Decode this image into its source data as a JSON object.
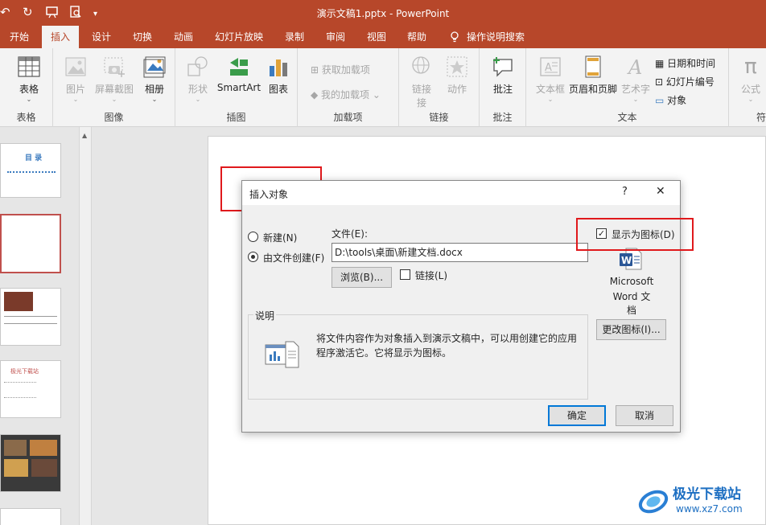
{
  "titlebar": {
    "title": "演示文稿1.pptx  -  PowerPoint",
    "qa_icons": [
      "undo-icon",
      "redo-icon",
      "start-from-beginning-icon",
      "print-preview-icon",
      "customize-qa-icon"
    ]
  },
  "tabs": [
    {
      "label": "开始"
    },
    {
      "label": "插入",
      "active": true
    },
    {
      "label": "设计"
    },
    {
      "label": "切换"
    },
    {
      "label": "动画"
    },
    {
      "label": "幻灯片放映"
    },
    {
      "label": "录制"
    },
    {
      "label": "审阅"
    },
    {
      "label": "视图"
    },
    {
      "label": "帮助"
    },
    {
      "label": "操作说明搜索"
    }
  ],
  "ribbon": {
    "groups": {
      "tables": "表格",
      "images": "图像",
      "illustrations": "插图",
      "addins": "加载项",
      "links": "链接",
      "comments": "批注",
      "text": "文本",
      "symbols": "符"
    },
    "buttons": {
      "table": "表格",
      "picture": "图片",
      "screenshot": "屏幕截图",
      "album": "相册",
      "shapes": "形状",
      "smartart": "SmartArt",
      "chart": "图表",
      "get_addins": "获取加载项",
      "my_addins": "我的加载项",
      "link": "链接",
      "link2": "接",
      "action": "动作",
      "comment": "批注",
      "textbox": "文本框",
      "header_footer": "页眉和页脚",
      "wordart": "艺术字",
      "datetime": "日期和时间",
      "slide_number": "幻灯片编号",
      "object": "对象",
      "equation": "公式"
    }
  },
  "thumbnails": {
    "slide1_title": "目  录",
    "slide4_title": "极光下载站"
  },
  "dialog": {
    "title": "插入对象",
    "help": "?",
    "close": "✕",
    "create_new": "新建(N)",
    "create_from_file": "由文件创建(F)",
    "file_label": "文件(E):",
    "file_value": "D:\\tools\\桌面\\新建文档.docx",
    "browse": "浏览(B)...",
    "link_label": "链接(L)",
    "display_as_icon": "显示为图标(D)",
    "display_as_icon_checked": true,
    "icon_caption_1": "Microsoft",
    "icon_caption_2": "Word 文",
    "icon_caption_3": "档",
    "change_icon": "更改图标(I)...",
    "desc_legend": "说明",
    "desc_line1": "将文件内容作为对象插入到演示文稿中，可以用创建它的应用",
    "desc_line2": "程序激活它。它将显示为图标。",
    "ok": "确定",
    "cancel": "取消"
  },
  "watermark": {
    "name": "极光下载站",
    "url": "www.xz7.com"
  }
}
